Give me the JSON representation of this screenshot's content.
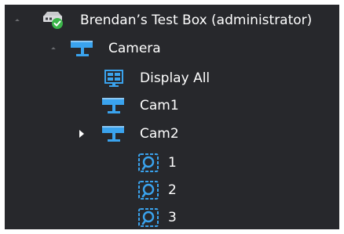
{
  "tree": {
    "root": {
      "label": "Brendan’s Test Box (administrator)",
      "icon": "server-online-icon",
      "expanded": true
    },
    "camera_group": {
      "label": "Camera",
      "icon": "camera-group-icon",
      "expanded": true
    },
    "display_all": {
      "label": "Display All",
      "icon": "display-all-icon"
    },
    "cam1": {
      "label": "Cam1",
      "icon": "camera-icon"
    },
    "cam2": {
      "label": "Cam2",
      "icon": "camera-icon",
      "expanded": false
    },
    "presets": [
      {
        "label": "1",
        "icon": "preset-icon"
      },
      {
        "label": "2",
        "icon": "preset-icon"
      },
      {
        "label": "3",
        "icon": "preset-icon"
      }
    ]
  },
  "colors": {
    "background": "#27282c",
    "text": "#ffffff",
    "icon_blue": "#3aa3ee",
    "online_green": "#3bb54a",
    "expander": "#6b6c70"
  }
}
